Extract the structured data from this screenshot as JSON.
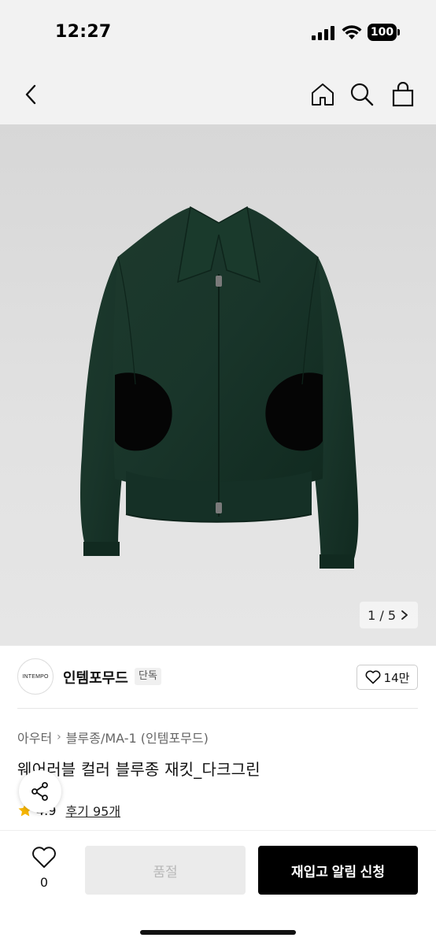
{
  "status_bar": {
    "time": "12:27",
    "battery": "100"
  },
  "header": {
    "icons": [
      "back-icon",
      "home-icon",
      "search-icon",
      "shopping-bag-icon"
    ]
  },
  "gallery": {
    "page_indicator": "1 / 5",
    "current": 1,
    "total": 5
  },
  "brand": {
    "logo_text": "INTEMPO",
    "name": "인템포무드",
    "badge": "단독",
    "likes": "14만"
  },
  "product": {
    "breadcrumb": [
      "아우터",
      "블루종/MA-1 (인템포무드)"
    ],
    "title": "웨어러블 컬러 블루종 재킷_다크그린",
    "rating": "4.9",
    "reviews": "후기 95개"
  },
  "bottom_bar": {
    "wish_count": "0",
    "soldout_label": "품절",
    "restock_label": "재입고 알림 신청"
  },
  "colors": {
    "jacket": "#1f3a2e",
    "accent_star": "#f5b400",
    "primary_button": "#000000",
    "disabled_button": "#ebebeb"
  }
}
